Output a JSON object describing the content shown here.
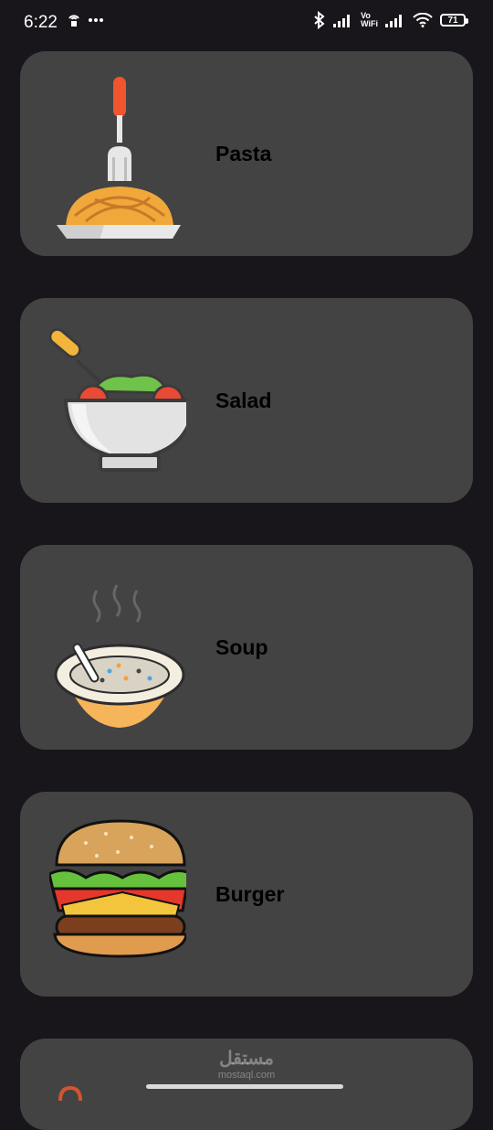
{
  "status_bar": {
    "time": "6:22",
    "vowifi_top": "Vo",
    "vowifi_bottom": "WiFi",
    "battery": "71"
  },
  "foods": [
    {
      "label": "Pasta",
      "icon": "pasta-plate-icon"
    },
    {
      "label": "Salad",
      "icon": "salad-bowl-icon"
    },
    {
      "label": "Soup",
      "icon": "soup-bowl-icon"
    },
    {
      "label": "Burger",
      "icon": "burger-icon"
    }
  ],
  "watermark": {
    "arabic": "مستقل",
    "latin": "mostaql.com"
  },
  "colors": {
    "background": "#18161b",
    "card": "#434343",
    "label": "#000000"
  }
}
